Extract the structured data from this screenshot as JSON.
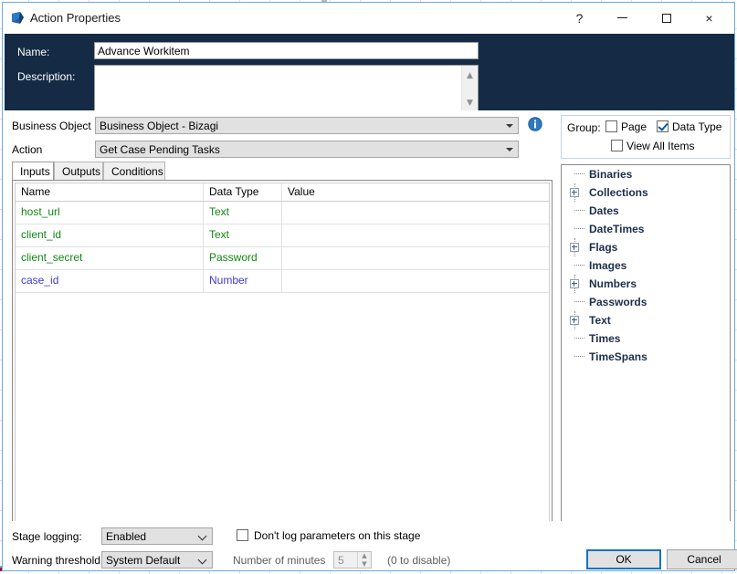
{
  "window": {
    "title": "Action Properties",
    "icon": "action-arrow-icon",
    "controls": {
      "help": "?",
      "minimize": "minimize-icon",
      "maximize": "maximize-icon",
      "close": "×"
    }
  },
  "header": {
    "name_label": "Name:",
    "name_value": "Advance Workitem",
    "name_placeholder": "",
    "description_label": "Description:",
    "description_value": "",
    "description_placeholder": ""
  },
  "selectors": {
    "business_object_label": "Business Object",
    "business_object_value": "Business Object - Bizagi",
    "action_label": "Action",
    "action_value": "Get Case Pending Tasks",
    "info_icon": "info-icon"
  },
  "tabs": [
    {
      "label": "Inputs",
      "active": true
    },
    {
      "label": "Outputs",
      "active": false
    },
    {
      "label": "Conditions",
      "active": false
    }
  ],
  "grid": {
    "columns": [
      "Name",
      "Data Type",
      "Value"
    ],
    "rows": [
      {
        "name": "host_url",
        "type": "Text",
        "value": "",
        "color": "green"
      },
      {
        "name": "client_id",
        "type": "Text",
        "value": "",
        "color": "green"
      },
      {
        "name": "client_secret",
        "type": "Password",
        "value": "",
        "color": "green"
      },
      {
        "name": "case_id",
        "type": "Number",
        "value": "",
        "color": "blue"
      }
    ]
  },
  "group_panel": {
    "title": "Group:",
    "page_label": "Page",
    "page_checked": false,
    "data_type_label": "Data Type",
    "data_type_checked": true,
    "view_all_label": "View All Items",
    "view_all_checked": false
  },
  "tree": {
    "items": [
      {
        "label": "Binaries",
        "expandable": false
      },
      {
        "label": "Collections",
        "expandable": true
      },
      {
        "label": "Dates",
        "expandable": false
      },
      {
        "label": "DateTimes",
        "expandable": false
      },
      {
        "label": "Flags",
        "expandable": true
      },
      {
        "label": "Images",
        "expandable": false
      },
      {
        "label": "Numbers",
        "expandable": true
      },
      {
        "label": "Passwords",
        "expandable": false
      },
      {
        "label": "Text",
        "expandable": true
      },
      {
        "label": "Times",
        "expandable": false
      },
      {
        "label": "TimeSpans",
        "expandable": false
      }
    ]
  },
  "bottom": {
    "stage_logging_label": "Stage logging:",
    "stage_logging_value": "Enabled",
    "warning_threshold_label": "Warning threshold:",
    "warning_threshold_value": "System Default",
    "dont_log_label": "Don't log parameters on this stage",
    "dont_log_checked": false,
    "number_of_minutes_label": "Number of minutes",
    "number_of_minutes_value": "5",
    "to_disable_label": "(0 to disable)",
    "ok_label": "OK",
    "cancel_label": "Cancel"
  },
  "colors": {
    "header_navy": "#152b45",
    "accent_blue": "#1474c4",
    "text_green": "#128715",
    "text_blue": "#3b3bdd",
    "tree_text": "#1b2f4a"
  }
}
